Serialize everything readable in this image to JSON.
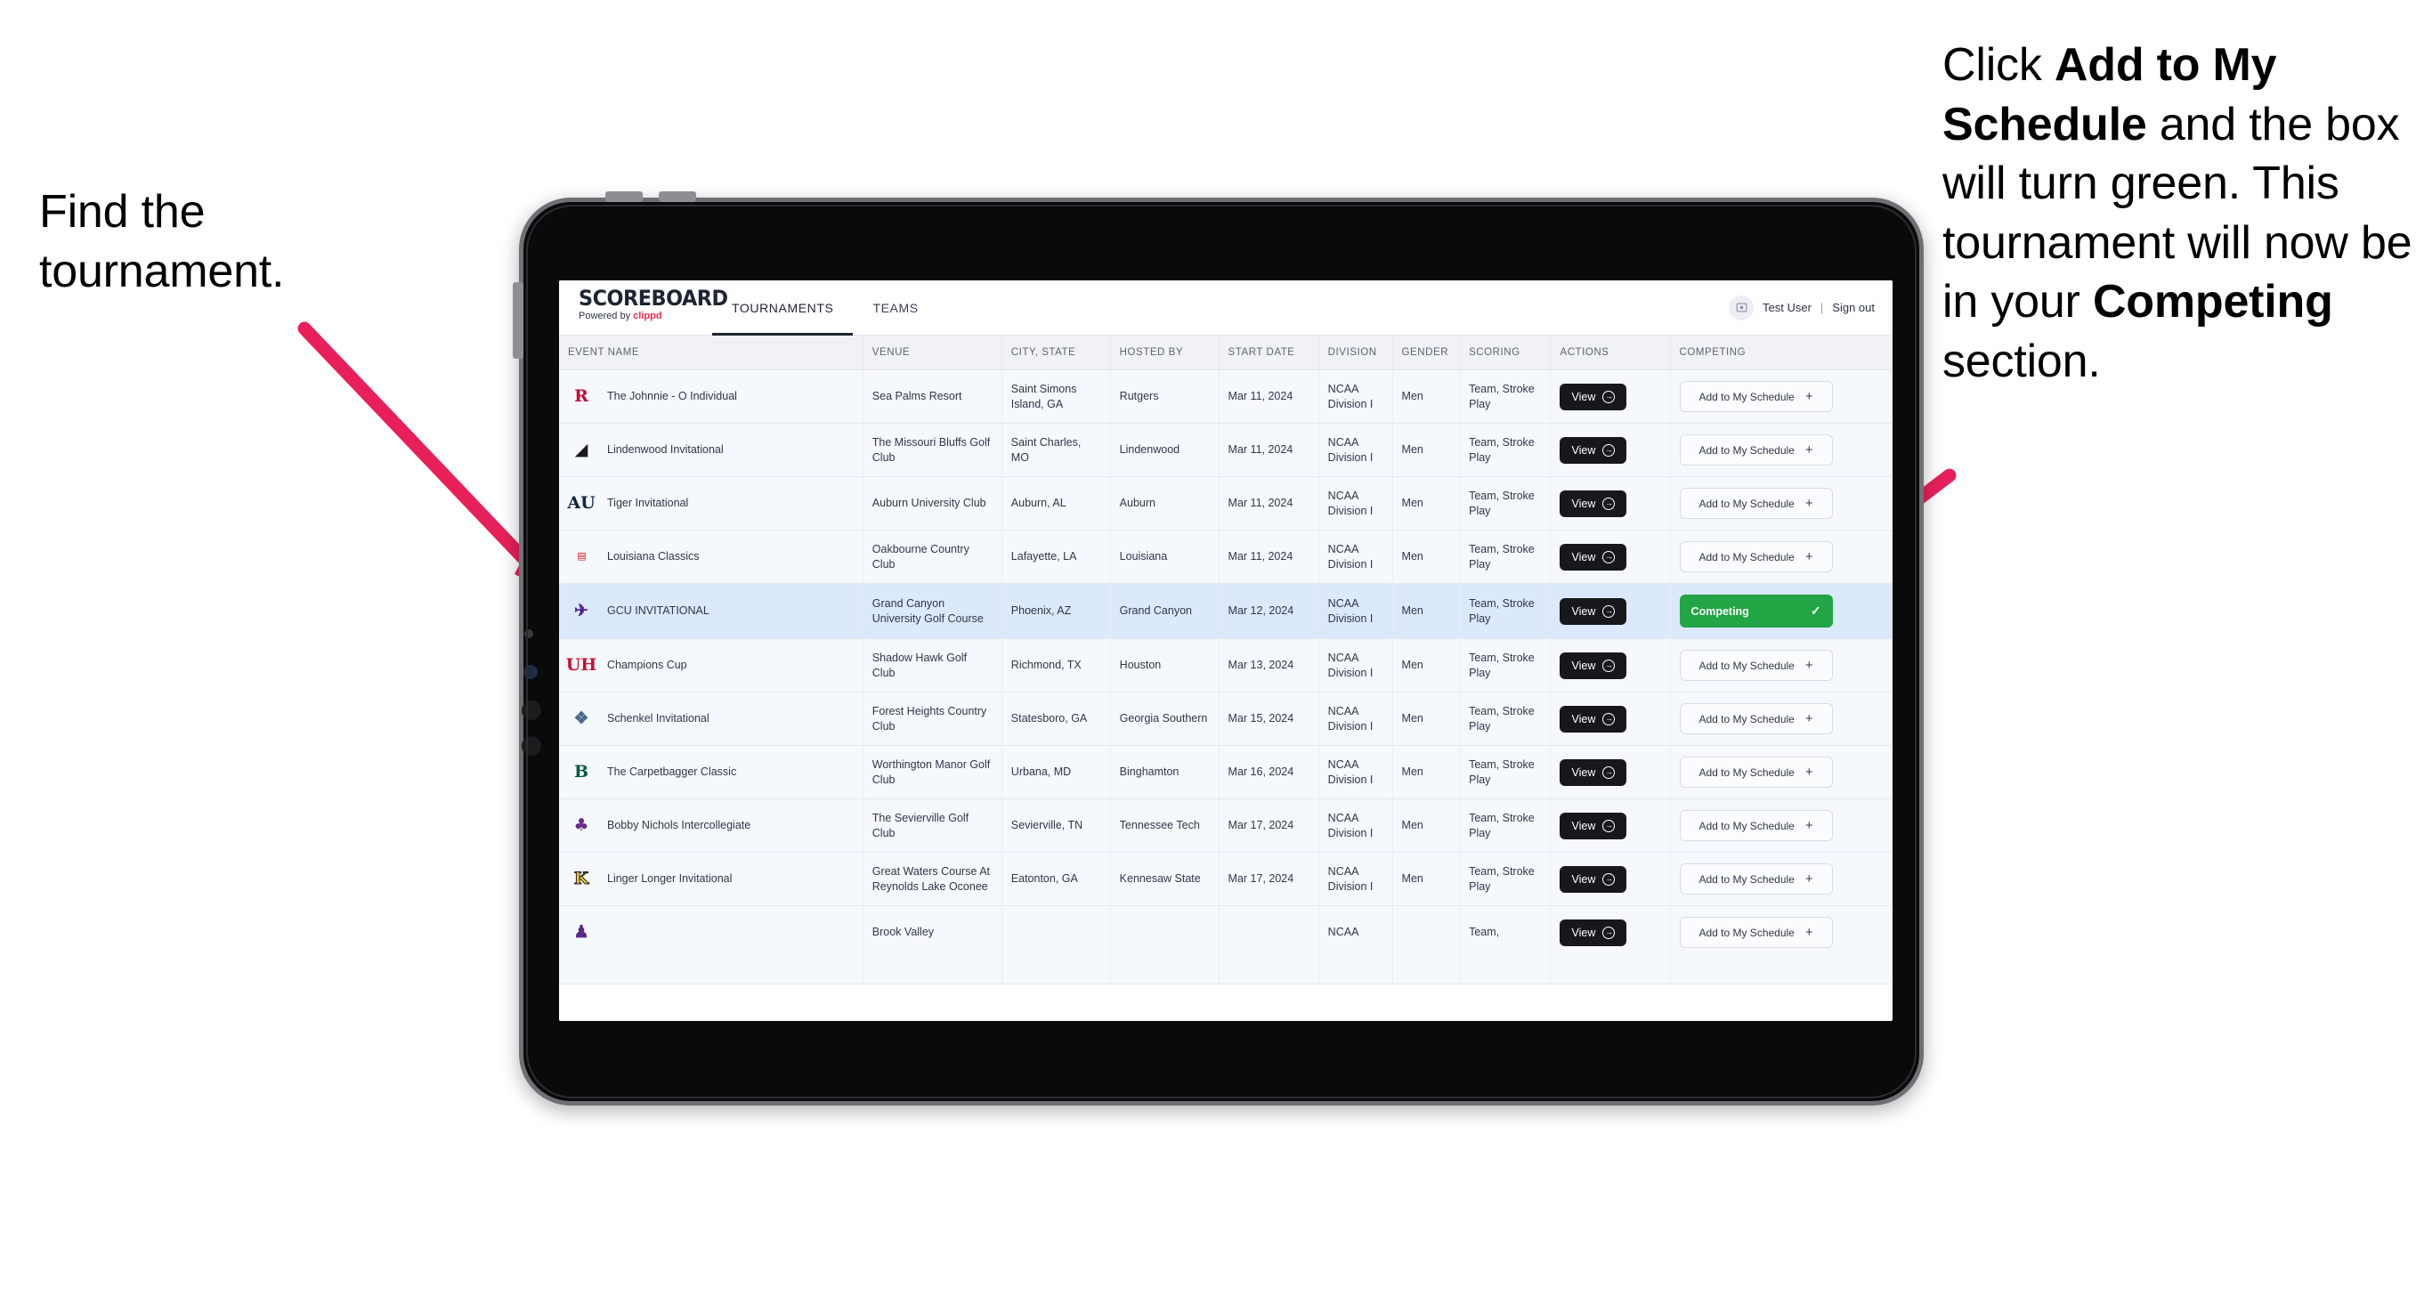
{
  "annotations": {
    "left": {
      "text": "Find the tournament."
    },
    "right": {
      "p1_pre": "Click ",
      "p1_bold": "Add to My Schedule",
      "p1_post": " and the box will turn green. This tournament will now be in your ",
      "p2_bold": "Competing",
      "p2_post": " section."
    },
    "arrow_color": "#e8205a"
  },
  "app": {
    "brand": {
      "wordmark": "SCOREBOARD",
      "powered_prefix": "Powered by ",
      "powered_brand": "clippd"
    },
    "tabs": [
      {
        "label": "TOURNAMENTS",
        "active": true
      },
      {
        "label": "TEAMS",
        "active": false
      }
    ],
    "account": {
      "avatar_icon": "user-avatar-icon",
      "user": "Test User",
      "separator": "|",
      "signout": "Sign out"
    }
  },
  "table": {
    "columns": [
      "EVENT NAME",
      "VENUE",
      "CITY, STATE",
      "HOSTED BY",
      "START DATE",
      "DIVISION",
      "GENDER",
      "SCORING",
      "ACTIONS",
      "COMPETING"
    ],
    "view_label": "View",
    "view_icon": "arrow-right-circle-icon",
    "add_label": "Add to My Schedule",
    "add_icon": "plus-icon",
    "competing_label": "Competing",
    "competing_icon": "check-icon",
    "competing_color": "#22a544",
    "rows": [
      {
        "logo": "R",
        "logo_class": "lg-rutgers",
        "event": "The Johnnie - O Individual",
        "venue": "Sea Palms Resort",
        "city": "Saint Simons Island, GA",
        "host": "Rutgers",
        "date": "Mar 11, 2024",
        "division": "NCAA Division I",
        "gender": "Men",
        "scoring": "Team, Stroke Play",
        "competing": false,
        "highlight": false
      },
      {
        "logo": "◢",
        "logo_class": "lg-lindenwood",
        "event": "Lindenwood Invitational",
        "venue": "The Missouri Bluffs Golf Club",
        "city": "Saint Charles, MO",
        "host": "Lindenwood",
        "date": "Mar 11, 2024",
        "division": "NCAA Division I",
        "gender": "Men",
        "scoring": "Team, Stroke Play",
        "competing": false,
        "highlight": false
      },
      {
        "logo": "AU",
        "logo_class": "lg-auburn",
        "event": "Tiger Invitational",
        "venue": "Auburn University Club",
        "city": "Auburn, AL",
        "host": "Auburn",
        "date": "Mar 11, 2024",
        "division": "NCAA Division I",
        "gender": "Men",
        "scoring": "Team, Stroke Play",
        "competing": false,
        "highlight": false
      },
      {
        "logo": "▤",
        "logo_class": "lg-louisiana",
        "event": "Louisiana Classics",
        "venue": "Oakbourne Country Club",
        "city": "Lafayette, LA",
        "host": "Louisiana",
        "date": "Mar 11, 2024",
        "division": "NCAA Division I",
        "gender": "Men",
        "scoring": "Team, Stroke Play",
        "competing": false,
        "highlight": false
      },
      {
        "logo": "✈",
        "logo_class": "lg-gcu",
        "event": "GCU INVITATIONAL",
        "venue": "Grand Canyon University Golf Course",
        "city": "Phoenix, AZ",
        "host": "Grand Canyon",
        "date": "Mar 12, 2024",
        "division": "NCAA Division I",
        "gender": "Men",
        "scoring": "Team, Stroke Play",
        "competing": true,
        "highlight": true
      },
      {
        "logo": "UH",
        "logo_class": "lg-houston",
        "event": "Champions Cup",
        "venue": "Shadow Hawk Golf Club",
        "city": "Richmond, TX",
        "host": "Houston",
        "date": "Mar 13, 2024",
        "division": "NCAA Division I",
        "gender": "Men",
        "scoring": "Team, Stroke Play",
        "competing": false,
        "highlight": false
      },
      {
        "logo": "❖",
        "logo_class": "lg-gasou",
        "event": "Schenkel Invitational",
        "venue": "Forest Heights Country Club",
        "city": "Statesboro, GA",
        "host": "Georgia Southern",
        "date": "Mar 15, 2024",
        "division": "NCAA Division I",
        "gender": "Men",
        "scoring": "Team, Stroke Play",
        "competing": false,
        "highlight": false
      },
      {
        "logo": "B",
        "logo_class": "lg-bing",
        "event": "The Carpetbagger Classic",
        "venue": "Worthington Manor Golf Club",
        "city": "Urbana, MD",
        "host": "Binghamton",
        "date": "Mar 16, 2024",
        "division": "NCAA Division I",
        "gender": "Men",
        "scoring": "Team, Stroke Play",
        "competing": false,
        "highlight": false
      },
      {
        "logo": "♣",
        "logo_class": "lg-tntech",
        "event": "Bobby Nichols Intercollegiate",
        "venue": "The Sevierville Golf Club",
        "city": "Sevierville, TN",
        "host": "Tennessee Tech",
        "date": "Mar 17, 2024",
        "division": "NCAA Division I",
        "gender": "Men",
        "scoring": "Team, Stroke Play",
        "competing": false,
        "highlight": false
      },
      {
        "logo": "K",
        "logo_class": "lg-kennesaw",
        "event": "Linger Longer Invitational",
        "venue": "Great Waters Course At Reynolds Lake Oconee",
        "city": "Eatonton, GA",
        "host": "Kennesaw State",
        "date": "Mar 17, 2024",
        "division": "NCAA Division I",
        "gender": "Men",
        "scoring": "Team, Stroke Play",
        "competing": false,
        "highlight": false
      },
      {
        "logo": "♟",
        "logo_class": "lg-ecu",
        "event": "",
        "venue": "Brook Valley",
        "city": "",
        "host": "",
        "date": "",
        "division": "NCAA",
        "gender": "",
        "scoring": "Team,",
        "competing": false,
        "highlight": false,
        "cut": true
      }
    ]
  }
}
